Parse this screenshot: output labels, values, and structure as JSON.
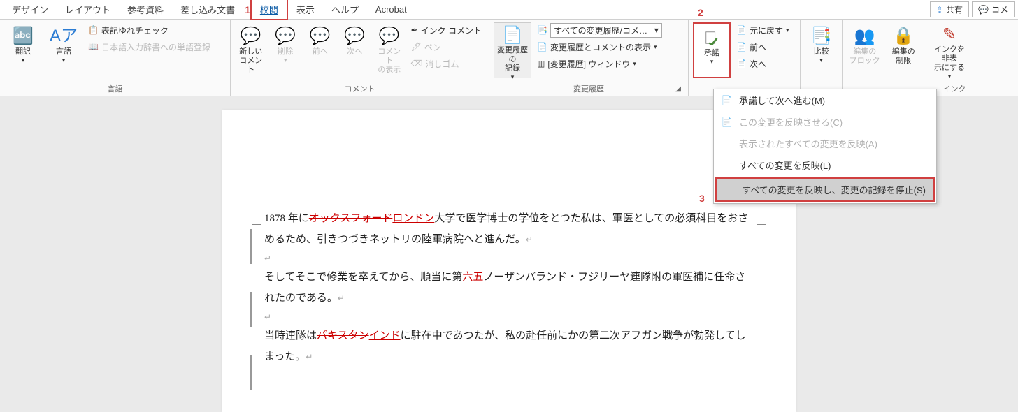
{
  "tabs": {
    "design": "デザイン",
    "layout": "レイアウト",
    "references": "参考資料",
    "mailings": "差し込み文書",
    "review": "校閲",
    "view": "表示",
    "help": "ヘルプ",
    "acrobat": "Acrobat"
  },
  "annotations": {
    "n1": "1",
    "n2": "2",
    "n3": "3"
  },
  "topright": {
    "share": "共有",
    "comments": "コメ"
  },
  "ribbon": {
    "language": {
      "translate": "翻訳",
      "language": "言語",
      "spellcheck": "表記ゆれチェック",
      "ime_dict": "日本語入力辞書への単語登録",
      "group": "言語"
    },
    "comments": {
      "new": "新しい\nコメント",
      "delete": "削除",
      "prev": "前へ",
      "next": "次へ",
      "show": "コメント\nの表示",
      "ink": "インク コメント",
      "pen": "ペン",
      "eraser": "消しゴム",
      "group": "コメント"
    },
    "tracking": {
      "track": "変更履歴の\n記録",
      "combo": "すべての変更履歴/コメ…",
      "show_markup": "変更履歴とコメントの表示",
      "pane": "[変更履歴] ウィンドウ",
      "group": "変更履歴"
    },
    "changes": {
      "accept": "承諾",
      "reject": "元に戻す",
      "prev": "前へ",
      "next": "次へ"
    },
    "compare": {
      "label": "比較"
    },
    "protect": {
      "block": "編集の\nブロック",
      "restrict": "編集の\n制限"
    },
    "ink_group": {
      "hide": "インクを非表\n示にする",
      "group": "インク"
    }
  },
  "menu": {
    "accept_next": "承諾して次へ進む(M)",
    "accept_this": "この変更を反映させる(C)",
    "accept_shown": "表示されたすべての変更を反映(A)",
    "accept_all": "すべての変更を反映(L)",
    "accept_all_stop": "すべての変更を反映し、変更の記録を停止(S)"
  },
  "document": {
    "p1a": "1878 年に",
    "p1_del": "オックスフォード",
    "p1_ins": "ロンドン",
    "p1b": "大学で医学博士の学位をとつた私は、軍医としての必須科目をおさめるため、引きつづきネットリの陸軍病院へと進んだ。",
    "p2a": "そしてそこで修業を卒えてから、順当に第",
    "p2_del": "六",
    "p2_ins": "五",
    "p2b": "ノーザンバランド・フジリーヤ連隊附の軍医補に任命されたのである。",
    "p3a": "当時連隊は",
    "p3_del": "パキスタン",
    "p3_ins": "インド",
    "p3b": "に駐在中であつたが、私の赴任前にかの第二次アフガン戦争が勃発してしまった。"
  }
}
